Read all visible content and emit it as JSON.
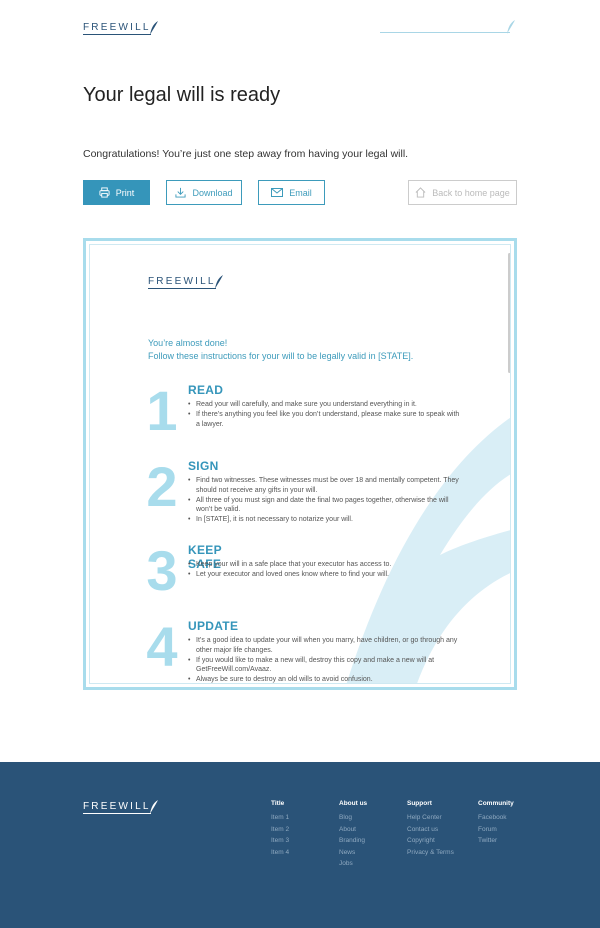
{
  "brand": {
    "name": "FREEWILL"
  },
  "header": {
    "title": "Your legal will is ready",
    "subtitle": "Congratulations! You’re just one step away from having your legal will."
  },
  "actions": {
    "print": "Print",
    "download": "Download",
    "email": "Email",
    "home": "Back to home page"
  },
  "document": {
    "intro1": "You’re almost done!",
    "intro2": "Follow these instructions for your will to be legally valid in [STATE].",
    "steps": [
      {
        "num": "1",
        "title": "READ",
        "items": [
          "Read your will carefully, and make sure you understand everything in it.",
          "If there’s anything you feel like you don’t understand, please make sure to speak with a lawyer."
        ]
      },
      {
        "num": "2",
        "title": "SIGN",
        "items": [
          "Find two witnesses. These witnesses must be over 18 and mentally competent. They should not receive any gifts in your will.",
          "All three of you must sign and date the final two pages together, otherwise the will won’t be valid.",
          "In [STATE], it is not necessary to notarize your will."
        ]
      },
      {
        "num": "3",
        "title": "KEEP SAFE",
        "items": [
          "Keep your will in a safe place that your executor has access to.",
          "Let your executor and loved ones know where to find your will."
        ]
      },
      {
        "num": "4",
        "title": "UPDATE",
        "items": [
          "It’s a good idea to update your will when you marry, have children, or go through any other major life changes.",
          "If you would like to make a new will, destroy this copy and make a new will at GetFreeWill.com/Avaaz.",
          "Always be sure to destroy an old wills to avoid confusion."
        ]
      }
    ]
  },
  "footer": {
    "columns": [
      {
        "title": "Title",
        "items": [
          "Item 1",
          "Item 2",
          "Item 3",
          "Item 4"
        ]
      },
      {
        "title": "About us",
        "items": [
          "Blog",
          "About",
          "Branding",
          "News",
          "Jobs"
        ]
      },
      {
        "title": "Support",
        "items": [
          "Help Center",
          "Contact us",
          "Copyright",
          "Privacy & Terms"
        ]
      },
      {
        "title": "Community",
        "items": [
          "Facebook",
          "Forum",
          "Twitter"
        ]
      }
    ]
  },
  "colors": {
    "accent": "#3595ba",
    "footer_bg": "#2a5378",
    "light_blue": "#a8dcec"
  },
  "icons": [
    "feather-icon",
    "printer-icon",
    "download-icon",
    "mail-icon",
    "home-icon"
  ]
}
